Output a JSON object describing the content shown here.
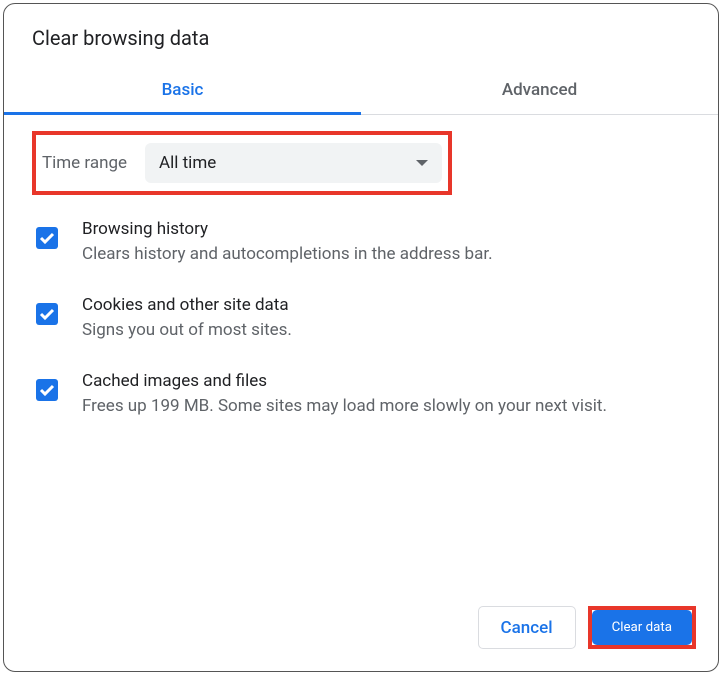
{
  "dialog": {
    "title": "Clear browsing data"
  },
  "tabs": {
    "basic": "Basic",
    "advanced": "Advanced"
  },
  "timeRange": {
    "label": "Time range",
    "value": "All time"
  },
  "options": [
    {
      "title": "Browsing history",
      "desc": "Clears history and autocompletions in the address bar."
    },
    {
      "title": "Cookies and other site data",
      "desc": "Signs you out of most sites."
    },
    {
      "title": "Cached images and files",
      "desc": "Frees up 199 MB. Some sites may load more slowly on your next visit."
    }
  ],
  "buttons": {
    "cancel": "Cancel",
    "clear": "Clear data"
  }
}
